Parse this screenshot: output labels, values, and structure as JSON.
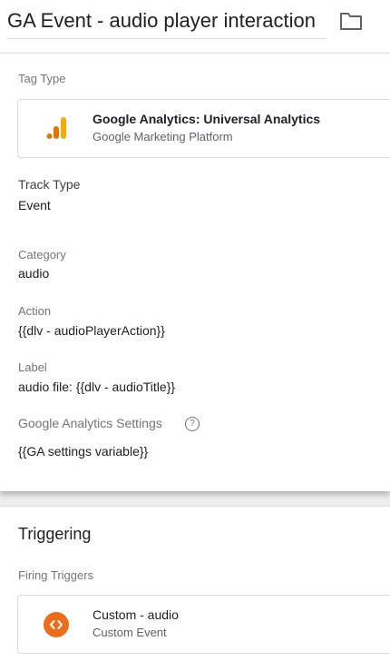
{
  "header": {
    "title": "GA Event - audio player interaction",
    "folder_icon": "folder-icon"
  },
  "tag_config": {
    "tag_type_label": "Tag Type",
    "tag_type_name": "Google Analytics: Universal Analytics",
    "tag_type_vendor": "Google Marketing Platform",
    "tag_type_icon": "google-analytics-icon",
    "track_type_label": "Track Type",
    "track_type_value": "Event",
    "category_label": "Category",
    "category_value": "audio",
    "action_label": "Action",
    "action_value": "{{dlv - audioPlayerAction}}",
    "label_label": "Label",
    "label_value": "audio file: {{dlv - audioTitle}}",
    "settings_label": "Google Analytics Settings",
    "settings_help": "?",
    "settings_value": "{{GA settings variable}}"
  },
  "triggering": {
    "title": "Triggering",
    "firing_label": "Firing Triggers",
    "trigger_name": "Custom - audio",
    "trigger_type": "Custom Event",
    "trigger_icon": "custom-event-icon"
  },
  "colors": {
    "accent_orange": "#ea6d1e",
    "ga_orange": "#f9ab00",
    "ga_dark_orange": "#e37400"
  }
}
